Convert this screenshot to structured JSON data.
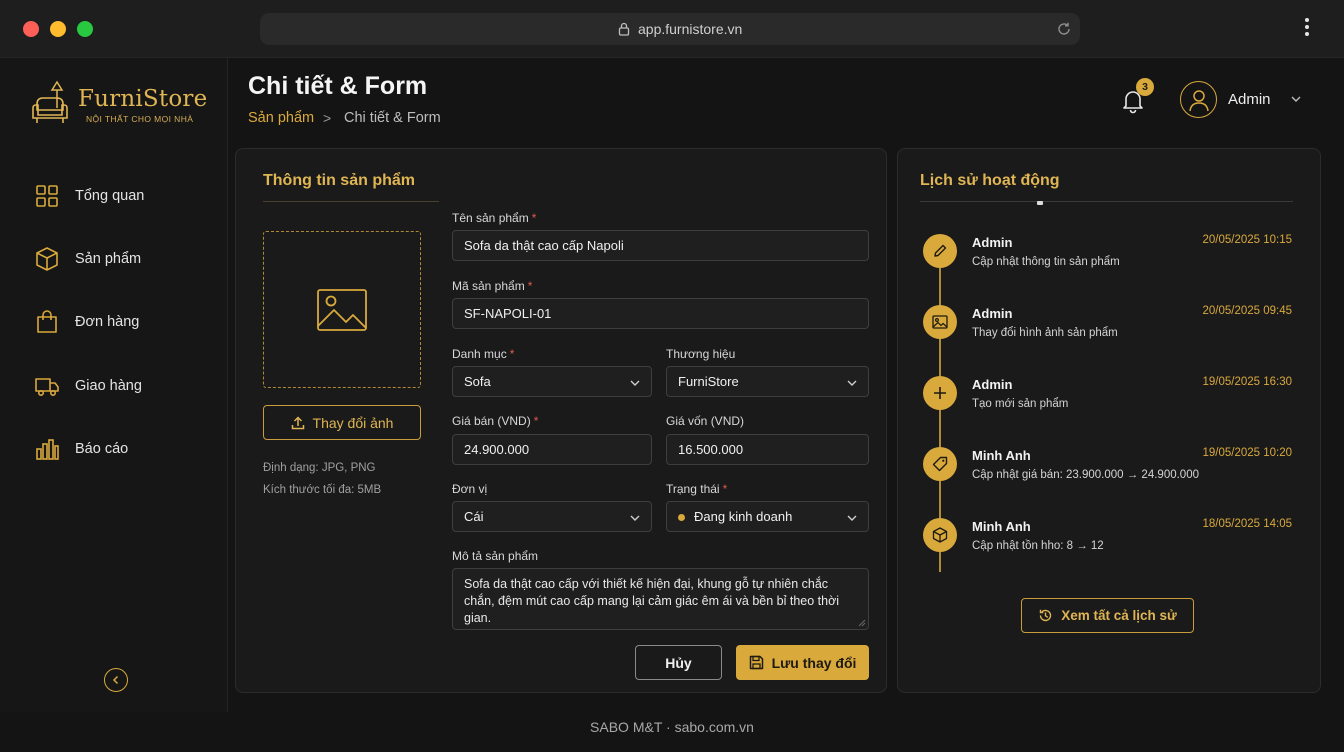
{
  "browser": {
    "url": "app.furnistore.vn"
  },
  "brand": {
    "name": "FurniStore",
    "tagline": "NỘI THẤT CHO MỌI NHÀ",
    "accent_color": "#d9a93c"
  },
  "sidebar": {
    "items": [
      {
        "label": "Tổng quan",
        "icon": "grid-icon"
      },
      {
        "label": "Sản phẩm",
        "icon": "box-icon"
      },
      {
        "label": "Đơn hàng",
        "icon": "bag-icon"
      },
      {
        "label": "Giao hàng",
        "icon": "truck-icon"
      },
      {
        "label": "Báo cáo",
        "icon": "bar-chart-icon"
      }
    ]
  },
  "header": {
    "title": "Chi tiết & Form",
    "breadcrumb": {
      "parent": "Sản phẩm",
      "separator": ">",
      "current": "Chi tiết & Form"
    },
    "notification_count": "3",
    "user_name": "Admin"
  },
  "product_form": {
    "section_title": "Thông tin sản phẩm",
    "change_image_label": "Thay đổi ảnh",
    "format_hint": "Định dạng: JPG, PNG",
    "size_hint": "Kích thước tối đa: 5MB",
    "required_mark": "*",
    "name": {
      "label": "Tên sản phẩm",
      "value": "Sofa da thật cao cấp Napoli"
    },
    "sku": {
      "label": "Mã sản phẩm",
      "value": "SF-NAPOLI-01"
    },
    "category": {
      "label": "Danh mục",
      "value": "Sofa"
    },
    "brand": {
      "label": "Thương hiệu",
      "value": "FurniStore"
    },
    "price": {
      "label": "Giá bán (VND)",
      "value": "24.900.000"
    },
    "cost": {
      "label": "Giá vốn (VND)",
      "value": "16.500.000"
    },
    "unit": {
      "label": "Đơn vị",
      "value": "Cái"
    },
    "status": {
      "label": "Trạng thái",
      "value": "Đang kinh doanh"
    },
    "description": {
      "label": "Mô tả sản phẩm",
      "value": "Sofa da thật cao cấp với thiết kế hiện đại, khung gỗ tự nhiên chắc chắn, đệm mút cao cấp mang lại cảm giác êm ái và bền bỉ theo thời gian."
    },
    "cancel_label": "Hủy",
    "save_label": "Lưu thay đổi"
  },
  "history": {
    "title": "Lịch sử hoạt động",
    "items": [
      {
        "user": "Admin",
        "desc": "Cập nhật thông tin sản phẩm",
        "time": "20/05/2025 10:15",
        "icon": "pencil-icon"
      },
      {
        "user": "Admin",
        "desc": "Thay đổi hình ảnh sản phẩm",
        "time": "20/05/2025 09:45",
        "icon": "image-icon"
      },
      {
        "user": "Admin",
        "desc": "Tạo mới sản phẩm",
        "time": "19/05/2025 16:30",
        "icon": "plus-icon"
      },
      {
        "user": "Minh Anh",
        "desc": "Cập nhật giá bán: 23.900.000 → 24.900.000",
        "time": "19/05/2025 10:20",
        "icon": "tag-icon"
      },
      {
        "user": "Minh Anh",
        "desc": "Cập nhật tồn hho: 8 → 12",
        "time": "18/05/2025 14:05",
        "icon": "box-icon"
      }
    ],
    "view_all_label": "Xem tất cả lịch sử"
  },
  "footer": {
    "text": "SABO M&T · sabo.com.vn"
  }
}
